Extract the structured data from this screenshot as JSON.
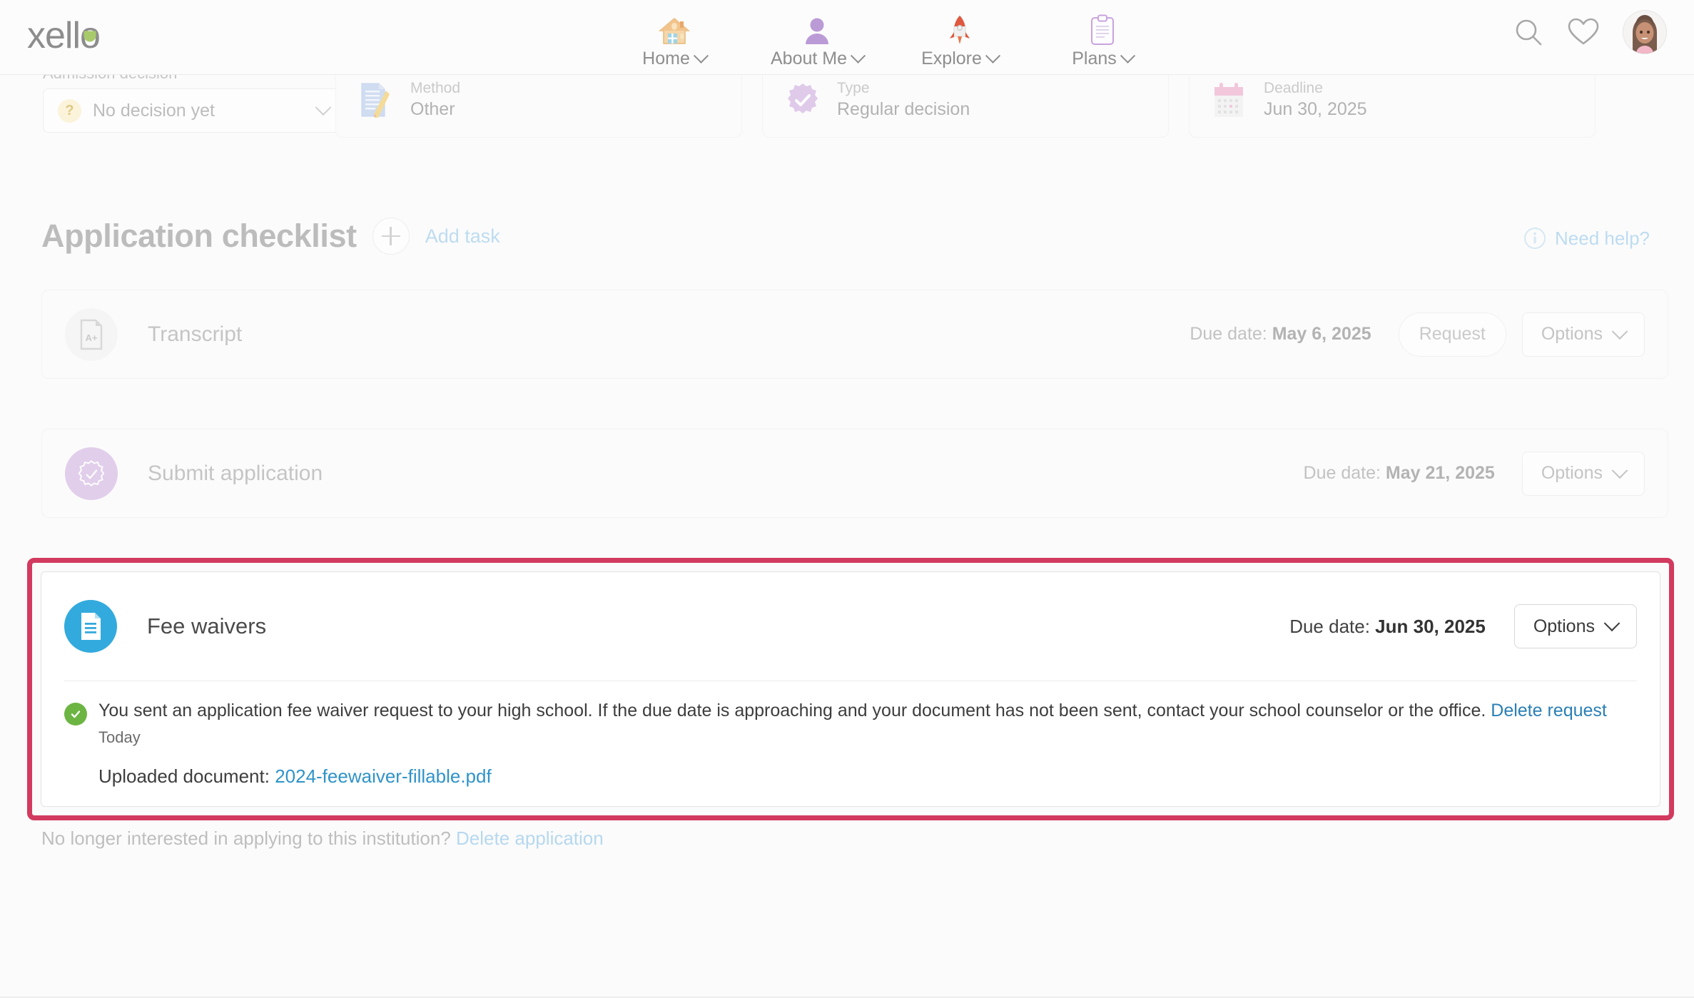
{
  "brand": {
    "name_left": "xell",
    "name_o": "o"
  },
  "nav": {
    "items": [
      {
        "label": "Home",
        "icon": "house-icon",
        "caret": true
      },
      {
        "label": "About Me",
        "icon": "person-icon",
        "caret": true
      },
      {
        "label": "Explore",
        "icon": "rocket-icon",
        "caret": true
      },
      {
        "label": "Plans",
        "icon": "clipboard-icon",
        "caret": true
      }
    ]
  },
  "header_actions": {
    "search": "search-icon",
    "favorites": "heart-icon",
    "avatar": "user-avatar"
  },
  "admission": {
    "label": "Admission decision",
    "selected": "No decision yet",
    "badge": "?"
  },
  "info_cards": [
    {
      "label": "Method",
      "value": "Other",
      "icon": "document-pencil-icon"
    },
    {
      "label": "Type",
      "value": "Regular decision",
      "icon": "badge-check-icon"
    },
    {
      "label": "Deadline",
      "value": "Jun 30, 2025",
      "icon": "calendar-icon"
    }
  ],
  "checklist": {
    "title": "Application checklist",
    "add_task_label": "Add task",
    "add_icon": "plus-icon",
    "need_help_label": "Need help?",
    "need_help_icon": "info-icon",
    "due_prefix": "Due date:",
    "tasks": [
      {
        "name": "Transcript",
        "icon": "transcript-a-plus-icon",
        "due_date": "May 6, 2025",
        "request_label": "Request",
        "options_label": "Options",
        "has_request": true
      },
      {
        "name": "Submit application",
        "icon": "badge-check-icon",
        "due_date": "May 21, 2025",
        "options_label": "Options",
        "has_request": false
      }
    ]
  },
  "fee_waiver": {
    "name": "Fee waivers",
    "icon": "document-icon",
    "due_prefix": "Due date:",
    "due_date": "Jun 30, 2025",
    "options_label": "Options",
    "status_icon": "check-circle-icon",
    "message": "You sent an application fee waiver request to your high school. If the due date is approaching and your document has not been sent, contact your school counselor or the office.",
    "delete_request_label": "Delete request",
    "timestamp": "Today",
    "uploaded_label": "Uploaded document:",
    "uploaded_file": "2024-feewaiver-fillable.pdf",
    "highlight_color": "#d23a5f"
  },
  "footer": {
    "text": "No longer interested in applying to this institution?",
    "delete_label": "Delete application"
  }
}
